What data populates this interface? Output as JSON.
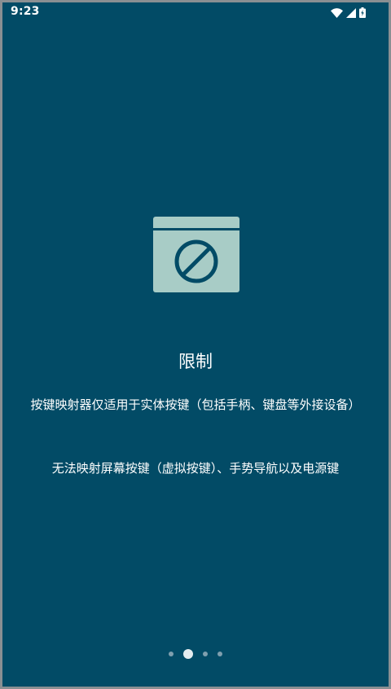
{
  "status_bar": {
    "time": "9:23",
    "icons": [
      "wifi-icon",
      "cellular-signal-icon",
      "battery-charging-icon"
    ]
  },
  "onboarding": {
    "illustration_icon": "blocked-window-icon",
    "title": "限制",
    "description_1": "按键映射器仅适用于实体按键（包括手柄、键盘等外接设备）",
    "description_2": "无法映射屏幕按键（虚拟按键）、手势导航以及电源键"
  },
  "pager": {
    "page_count": 4,
    "active_index": 1
  },
  "colors": {
    "background": "#024b66",
    "illustration_fill": "#a8ccc6",
    "text": "#ffffff",
    "dot_active": "#e4ecef",
    "dot_inactive": "#7f9fae"
  }
}
